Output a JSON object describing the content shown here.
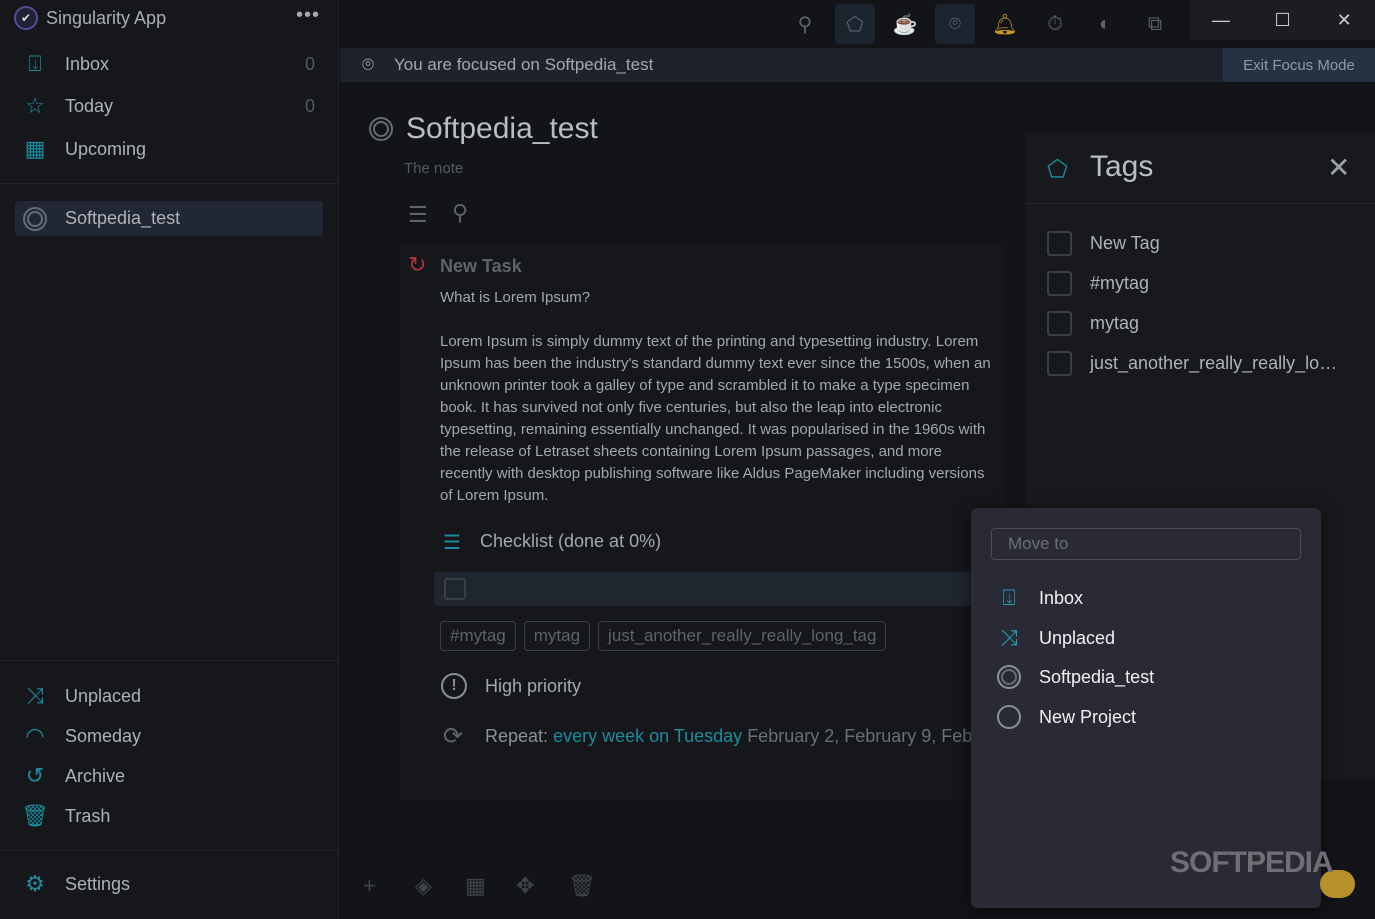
{
  "app": {
    "title": "Singularity App",
    "menu_icon": "more-dots-icon"
  },
  "sidebar": {
    "top_items": [
      {
        "label": "Inbox",
        "count": "0",
        "icon": "inbox-icon"
      },
      {
        "label": "Today",
        "count": "0",
        "icon": "star-icon"
      },
      {
        "label": "Upcoming",
        "icon": "calendar-icon"
      }
    ],
    "projects": [
      {
        "label": "Softpedia_test",
        "icon": "project-ring-icon"
      }
    ],
    "bottom_items": [
      {
        "label": "Unplaced",
        "icon": "shuffle-icon"
      },
      {
        "label": "Someday",
        "icon": "rainbow-icon"
      },
      {
        "label": "Archive",
        "icon": "history-icon"
      },
      {
        "label": "Trash",
        "icon": "trash-icon"
      }
    ],
    "settings": "Settings"
  },
  "toolbar": {
    "icons": [
      "search-icon",
      "tag-icon",
      "coffee-icon",
      "focus-icon",
      "bell-icon",
      "timer-icon",
      "contrast-icon",
      "copy-icon"
    ],
    "active": [
      "tag-icon",
      "focus-icon"
    ],
    "bell_color": "#c99a22"
  },
  "banner": {
    "text": "You are focused on Softpedia_test",
    "exit": "Exit Focus Mode"
  },
  "project": {
    "title": "Softpedia_test",
    "note": "The note"
  },
  "task": {
    "title": "New Task",
    "body": "What is Lorem Ipsum?\n\nLorem Ipsum is simply dummy text of the printing and typesetting industry. Lorem Ipsum has been the industry's standard dummy text ever since the 1500s, when an unknown printer took a galley of type and scrambled it to make a type specimen book. It has survived not only five centuries, but also the leap into electronic typesetting, remaining essentially unchanged. It was popularised in the 1960s with the release of Letraset sheets containing Lorem Ipsum passages, and more recently with desktop publishing software like Aldus PageMaker including versions of Lorem Ipsum.",
    "checklist": "Checklist (done at 0%)",
    "tags": [
      "#mytag",
      "mytag",
      "just_another_really_really_long_tag"
    ],
    "priority": "High priority",
    "repeat_label": "Repeat:",
    "repeat_rule": "every week on Tuesday",
    "repeat_dates": "February 2, February 9, Feb"
  },
  "tags_panel": {
    "title": "Tags",
    "items": [
      "New Tag",
      "#mytag",
      "mytag",
      "just_another_really_really_lo…"
    ]
  },
  "move_popup": {
    "placeholder": "Move to",
    "items": [
      "Inbox",
      "Unplaced",
      "Softpedia_test",
      "New Project"
    ]
  },
  "watermark": "SOFTPEDIA",
  "accent": "#1b8c9e"
}
